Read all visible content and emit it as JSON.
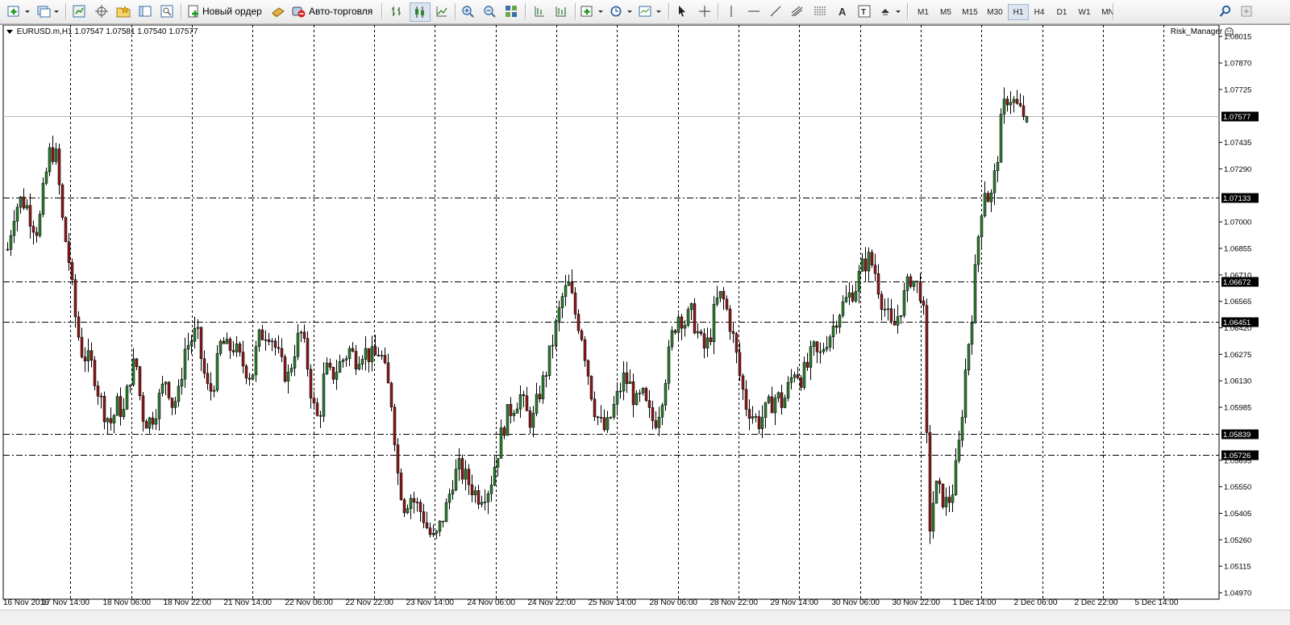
{
  "toolbar": {
    "new_order_label": "Новый ордер",
    "autotrading_label": "Авто-торговля",
    "timeframes": [
      "M1",
      "M5",
      "M15",
      "M30",
      "H1",
      "H4",
      "D1",
      "W1",
      "MN"
    ],
    "active_timeframe": "H1"
  },
  "chart": {
    "title": "EURUSD.m,H1  1.07547 1.07581 1.07540 1.07577",
    "indicator": "Risk_Manager",
    "bull_color": "#2e7d32",
    "bear_color": "#8b1a1a",
    "grid_color": "#000000"
  },
  "chart_data": {
    "type": "candlestick",
    "symbol": "EURUSD.m",
    "timeframe": "H1",
    "ohlc_last": {
      "open": 1.07547,
      "high": 1.07581,
      "low": 1.0754,
      "close": 1.07577
    },
    "ylim": [
      1.0497,
      1.0806
    ],
    "y_ticks": [
      "1.08015",
      "1.07870",
      "1.07725",
      "1.07435",
      "1.07290",
      "1.07000",
      "1.06855",
      "1.06710",
      "1.06565",
      "1.06420",
      "1.06275",
      "1.06130",
      "1.05985",
      "1.05695",
      "1.05550",
      "1.05405",
      "1.05260",
      "1.05115",
      "1.04970"
    ],
    "x_labels": [
      "16 Nov 2016",
      "17 Nov 14:00",
      "18 Nov 06:00",
      "18 Nov 22:00",
      "21 Nov 14:00",
      "22 Nov 06:00",
      "22 Nov 22:00",
      "23 Nov 14:00",
      "24 Nov 06:00",
      "24 Nov 22:00",
      "25 Nov 14:00",
      "28 Nov 06:00",
      "28 Nov 22:00",
      "29 Nov 14:00",
      "30 Nov 06:00",
      "30 Nov 22:00",
      "1 Dec 14:00",
      "2 Dec 06:00",
      "2 Dec 22:00",
      "5 Dec 14:00"
    ],
    "levels": [
      {
        "price": 1.07577,
        "label": "1.07577",
        "style": "solid"
      },
      {
        "price": 1.07133,
        "label": "1.07133",
        "style": "dashdot"
      },
      {
        "price": 1.06672,
        "label": "1.06672",
        "style": "dashdot"
      },
      {
        "price": 1.06451,
        "label": "1.06451",
        "style": "dashdot"
      },
      {
        "price": 1.05839,
        "label": "1.05839",
        "style": "dashdot"
      },
      {
        "price": 1.05726,
        "label": "1.05726",
        "style": "dashdot"
      }
    ],
    "close_path": [
      1.0685,
      1.0705,
      1.0712,
      1.071,
      1.07,
      1.0695,
      1.072,
      1.074,
      1.0735,
      1.07,
      1.068,
      1.065,
      1.063,
      1.0625,
      1.062,
      1.0605,
      1.0595,
      1.059,
      1.06,
      1.0595,
      1.0615,
      1.0625,
      1.0595,
      1.059,
      1.0595,
      1.0605,
      1.0615,
      1.06,
      1.0605,
      1.063,
      1.0635,
      1.064,
      1.062,
      1.0605,
      1.0615,
      1.0635,
      1.063,
      1.0632,
      1.0625,
      1.062,
      1.0615,
      1.0635,
      1.064,
      1.064,
      1.063,
      1.062,
      1.0615,
      1.063,
      1.064,
      1.0625,
      1.06,
      1.059,
      1.062,
      1.0615,
      1.062,
      1.0625,
      1.063,
      1.0625,
      1.063,
      1.0628,
      1.0625,
      1.063,
      1.0615,
      1.06,
      1.056,
      1.0545,
      1.055,
      1.0545,
      1.054,
      1.053,
      1.0525,
      1.0535,
      1.0545,
      1.056,
      1.0565,
      1.056,
      1.0555,
      1.055,
      1.0552,
      1.0555,
      1.057,
      1.0585,
      1.0595,
      1.06,
      1.0605,
      1.0595,
      1.059,
      1.0605,
      1.0615,
      1.063,
      1.0645,
      1.066,
      1.0665,
      1.065,
      1.064,
      1.062,
      1.06,
      1.059,
      1.0585,
      1.0595,
      1.0605,
      1.0615,
      1.061,
      1.06,
      1.0605,
      1.0595,
      1.059,
      1.06,
      1.062,
      1.064,
      1.065,
      1.0645,
      1.065,
      1.064,
      1.063,
      1.0635,
      1.0655,
      1.066,
      1.065,
      1.0635,
      1.0615,
      1.06,
      1.0595,
      1.059,
      1.0595,
      1.06,
      1.0605,
      1.06,
      1.061,
      1.062,
      1.0615,
      1.062,
      1.063,
      1.0625,
      1.0635,
      1.064,
      1.065,
      1.0655,
      1.066,
      1.0665,
      1.0675,
      1.068,
      1.0675,
      1.066,
      1.065,
      1.064,
      1.065,
      1.066,
      1.067,
      1.0665,
      1.066,
      1.053,
      1.0555,
      1.055,
      1.0545,
      1.0555,
      1.058,
      1.062,
      1.065,
      1.069,
      1.072,
      1.071,
      1.073,
      1.076,
      1.077,
      1.0765,
      1.076,
      1.0758
    ]
  }
}
